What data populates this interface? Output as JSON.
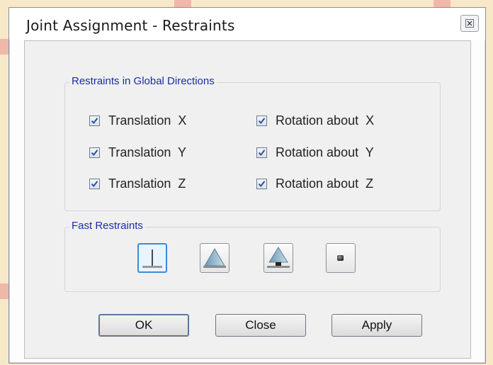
{
  "window": {
    "title": "Joint Assignment - Restraints",
    "close_icon": "close-icon"
  },
  "restraints_group": {
    "label": "Restraints in Global Directions",
    "checkboxes": [
      {
        "label": "Translation  X",
        "checked": true
      },
      {
        "label": "Translation  Y",
        "checked": true
      },
      {
        "label": "Translation  Z",
        "checked": true
      },
      {
        "label": "Rotation about  X",
        "checked": true
      },
      {
        "label": "Rotation about  Y",
        "checked": true
      },
      {
        "label": "Rotation about  Z",
        "checked": true
      }
    ]
  },
  "fast_restraints_group": {
    "label": "Fast Restraints",
    "buttons": [
      {
        "icon": "fixed-support-icon",
        "active": true
      },
      {
        "icon": "pinned-support-icon",
        "active": false
      },
      {
        "icon": "roller-support-icon",
        "active": false
      },
      {
        "icon": "free-joint-icon",
        "active": false
      }
    ]
  },
  "buttons": {
    "ok": "OK",
    "close": "Close",
    "apply": "Apply"
  },
  "colors": {
    "group_label": "#1c2da0",
    "active_button_border": "#3c8ad6",
    "checkmark": "#2a4fa8"
  }
}
